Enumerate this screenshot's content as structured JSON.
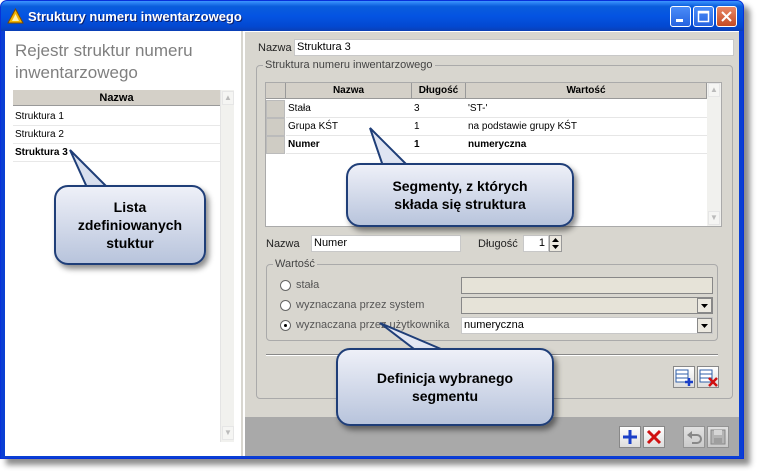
{
  "window": {
    "title": "Struktury numeru inwentarzowego"
  },
  "left": {
    "heading": "Rejestr struktur numeru inwentarzowego",
    "grid_header": "Nazwa",
    "rows": [
      {
        "label": "Struktura 1",
        "bold": false
      },
      {
        "label": "Struktura 2",
        "bold": false
      },
      {
        "label": "Struktura 3",
        "bold": true
      }
    ]
  },
  "form": {
    "name_label": "Nazwa",
    "name_value": "Struktura 3",
    "group_label": "Struktura numeru inwentarzowego",
    "columns": [
      "Nazwa",
      "Długość",
      "Wartość"
    ],
    "segments": [
      {
        "name": "Stała",
        "length": "3",
        "value": "'ST-'",
        "bold": false
      },
      {
        "name": "Grupa KŚT",
        "length": "1",
        "value": "na podstawie grupy KŚT",
        "bold": false
      },
      {
        "name": "Numer",
        "length": "1",
        "value": "numeryczna",
        "bold": true
      }
    ],
    "seg_name_label": "Nazwa",
    "seg_name_value": "Numer",
    "length_label": "Długość",
    "length_value": "1",
    "value_group_label": "Wartość",
    "options": {
      "fixed": "stała",
      "system": "wyznaczana przez system",
      "user": "wyznaczana przez użytkownika"
    },
    "user_select_value": "numeryczna"
  },
  "callouts": {
    "list": "Lista zdefiniowanych stuktur",
    "segments": "Segmenty, z których składa się struktura",
    "definition": "Definicja wybranego segmentu"
  },
  "icons": {
    "add_row": "add-row-icon",
    "delete_row": "delete-row-icon",
    "add": "plus-icon",
    "delete": "delete-icon",
    "undo": "undo-icon",
    "save": "save-icon"
  },
  "colors": {
    "title_bar": "#0454e2",
    "panel": "#d8d6cf",
    "callout_border": "#1f3e78"
  }
}
